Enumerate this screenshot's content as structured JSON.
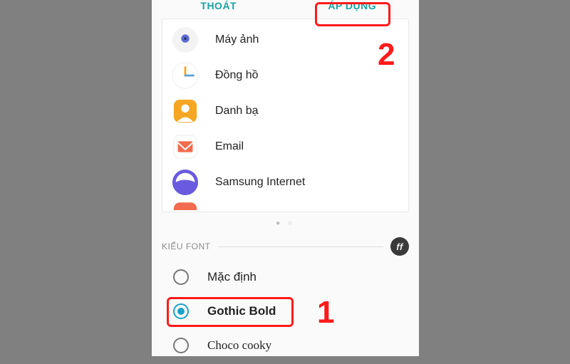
{
  "topbar": {
    "cancel_label": "THOÁT",
    "apply_label": "ÁP DỤNG"
  },
  "preview": {
    "items": [
      {
        "label": "Máy ảnh"
      },
      {
        "label": "Đồng hồ"
      },
      {
        "label": "Danh bạ"
      },
      {
        "label": "Email"
      },
      {
        "label": "Samsung Internet"
      }
    ]
  },
  "section": {
    "title": "KIỂU FONT",
    "badge": "ff"
  },
  "fonts": {
    "items": [
      {
        "label": "Mặc định",
        "selected": false
      },
      {
        "label": "Gothic Bold",
        "selected": true
      },
      {
        "label": "Choco cooky",
        "selected": false
      }
    ]
  },
  "annotations": {
    "num1": "1",
    "num2": "2"
  }
}
